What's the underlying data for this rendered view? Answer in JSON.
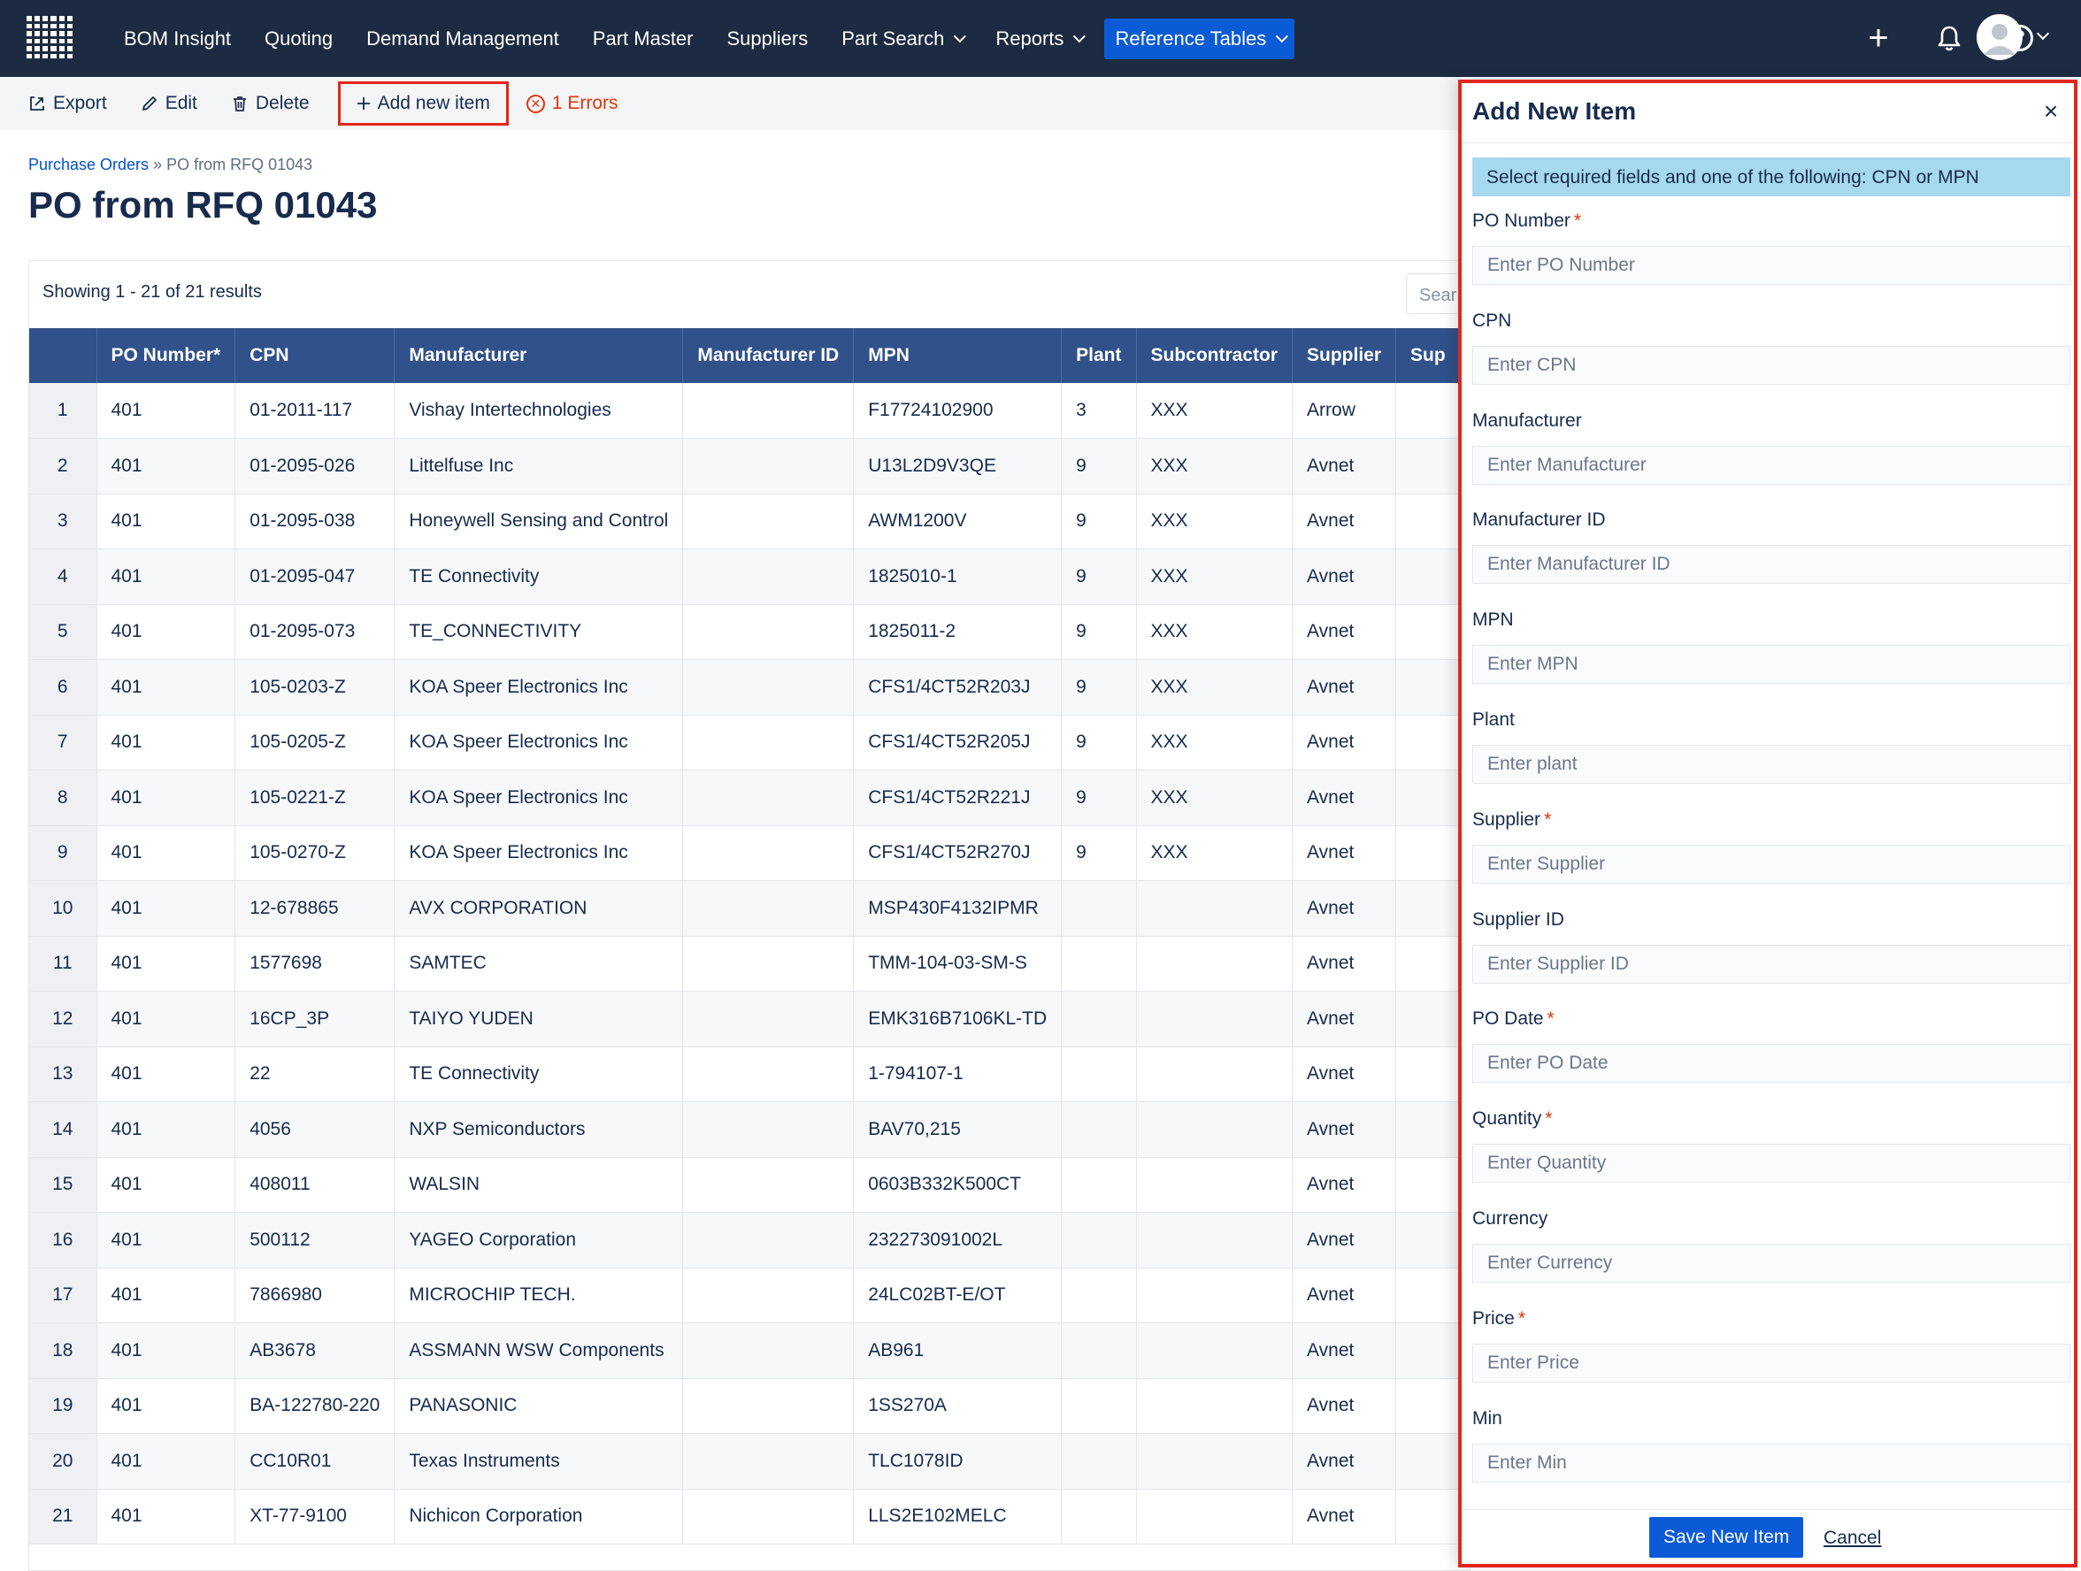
{
  "nav": {
    "items": [
      {
        "label": "BOM Insight",
        "dropdown": false
      },
      {
        "label": "Quoting",
        "dropdown": false
      },
      {
        "label": "Demand Management",
        "dropdown": false
      },
      {
        "label": "Part Master",
        "dropdown": false
      },
      {
        "label": "Suppliers",
        "dropdown": false
      },
      {
        "label": "Part Search",
        "dropdown": true
      },
      {
        "label": "Reports",
        "dropdown": true
      },
      {
        "label": "Reference Tables",
        "dropdown": true,
        "active": true
      }
    ],
    "plus_glyph": "+",
    "help_glyph": "?"
  },
  "toolbar": {
    "export": "Export",
    "edit": "Edit",
    "delete": "Delete",
    "add_new": "Add new item",
    "errors": "1 Errors"
  },
  "breadcrumb": {
    "parent": "Purchase Orders",
    "sep": "»",
    "current": "PO from RFQ 01043"
  },
  "page_title": "PO from RFQ 01043",
  "table": {
    "showing": "Showing 1 - 21 of 21 results",
    "search_placeholder": "Sear",
    "columns": [
      "PO Number*",
      "CPN",
      "Manufacturer",
      "Manufacturer ID",
      "MPN",
      "Plant",
      "Subcontractor",
      "Supplier",
      "Sup"
    ],
    "rows": [
      [
        "1",
        "401",
        "01-2011-117",
        "Vishay Intertechnologies",
        "",
        "F17724102900",
        "3",
        "XXX",
        "Arrow",
        ""
      ],
      [
        "2",
        "401",
        "01-2095-026",
        "Littelfuse Inc",
        "",
        "U13L2D9V3QE",
        "9",
        "XXX",
        "Avnet",
        ""
      ],
      [
        "3",
        "401",
        "01-2095-038",
        "Honeywell Sensing and Control",
        "",
        "AWM1200V",
        "9",
        "XXX",
        "Avnet",
        ""
      ],
      [
        "4",
        "401",
        "01-2095-047",
        "TE Connectivity",
        "",
        "1825010-1",
        "9",
        "XXX",
        "Avnet",
        ""
      ],
      [
        "5",
        "401",
        "01-2095-073",
        "TE_CONNECTIVITY",
        "",
        "1825011-2",
        "9",
        "XXX",
        "Avnet",
        ""
      ],
      [
        "6",
        "401",
        "105-0203-Z",
        "KOA Speer Electronics Inc",
        "",
        "CFS1/4CT52R203J",
        "9",
        "XXX",
        "Avnet",
        ""
      ],
      [
        "7",
        "401",
        "105-0205-Z",
        "KOA Speer Electronics Inc",
        "",
        "CFS1/4CT52R205J",
        "9",
        "XXX",
        "Avnet",
        ""
      ],
      [
        "8",
        "401",
        "105-0221-Z",
        "KOA Speer Electronics Inc",
        "",
        "CFS1/4CT52R221J",
        "9",
        "XXX",
        "Avnet",
        ""
      ],
      [
        "9",
        "401",
        "105-0270-Z",
        "KOA Speer Electronics Inc",
        "",
        "CFS1/4CT52R270J",
        "9",
        "XXX",
        "Avnet",
        ""
      ],
      [
        "10",
        "401",
        "12-678865",
        "AVX CORPORATION",
        "",
        "MSP430F4132IPMR",
        "",
        "",
        "Avnet",
        ""
      ],
      [
        "11",
        "401",
        "1577698",
        "SAMTEC",
        "",
        "TMM-104-03-SM-S",
        "",
        "",
        "Avnet",
        ""
      ],
      [
        "12",
        "401",
        "16CP_3P",
        "TAIYO YUDEN",
        "",
        "EMK316B7106KL-TD",
        "",
        "",
        "Avnet",
        ""
      ],
      [
        "13",
        "401",
        "22",
        "TE Connectivity",
        "",
        "1-794107-1",
        "",
        "",
        "Avnet",
        ""
      ],
      [
        "14",
        "401",
        "4056",
        "NXP Semiconductors",
        "",
        "BAV70,215",
        "",
        "",
        "Avnet",
        ""
      ],
      [
        "15",
        "401",
        "408011",
        "WALSIN",
        "",
        "0603B332K500CT",
        "",
        "",
        "Avnet",
        ""
      ],
      [
        "16",
        "401",
        "500112",
        "YAGEO Corporation",
        "",
        "232273091002L",
        "",
        "",
        "Avnet",
        ""
      ],
      [
        "17",
        "401",
        "7866980",
        "MICROCHIP TECH.",
        "",
        "24LC02BT-E/OT",
        "",
        "",
        "Avnet",
        ""
      ],
      [
        "18",
        "401",
        "AB3678",
        "ASSMANN WSW Components",
        "",
        "AB961",
        "",
        "",
        "Avnet",
        ""
      ],
      [
        "19",
        "401",
        "BA-122780-220",
        "PANASONIC",
        "",
        "1SS270A",
        "",
        "",
        "Avnet",
        ""
      ],
      [
        "20",
        "401",
        "CC10R01",
        "Texas Instruments",
        "",
        "TLC1078ID",
        "",
        "",
        "Avnet",
        ""
      ],
      [
        "21",
        "401",
        "XT-77-9100",
        "Nichicon Corporation",
        "",
        "LLS2E102MELC",
        "",
        "",
        "Avnet",
        ""
      ]
    ]
  },
  "panel": {
    "title": "Add New Item",
    "close_glyph": "×",
    "info": "Select required fields and one of the following: CPN or MPN",
    "fields": [
      {
        "label": "PO Number",
        "required": true,
        "placeholder": "Enter PO Number"
      },
      {
        "label": "CPN",
        "required": false,
        "placeholder": "Enter CPN"
      },
      {
        "label": "Manufacturer",
        "required": false,
        "placeholder": "Enter Manufacturer"
      },
      {
        "label": "Manufacturer ID",
        "required": false,
        "placeholder": "Enter Manufacturer ID"
      },
      {
        "label": "MPN",
        "required": false,
        "placeholder": "Enter MPN"
      },
      {
        "label": "Plant",
        "required": false,
        "placeholder": "Enter plant"
      },
      {
        "label": "Supplier",
        "required": true,
        "placeholder": "Enter Supplier"
      },
      {
        "label": "Supplier ID",
        "required": false,
        "placeholder": "Enter Supplier ID"
      },
      {
        "label": "PO Date",
        "required": true,
        "placeholder": "Enter PO Date"
      },
      {
        "label": "Quantity",
        "required": true,
        "placeholder": "Enter Quantity"
      },
      {
        "label": "Currency",
        "required": false,
        "placeholder": "Enter Currency"
      },
      {
        "label": "Price",
        "required": true,
        "placeholder": "Enter Price"
      },
      {
        "label": "Min",
        "required": false,
        "placeholder": "Enter Min"
      }
    ],
    "required_mark": "*",
    "save": "Save New Item",
    "cancel": "Cancel"
  },
  "colors": {
    "nav_bg": "#1c2b41",
    "accent": "#0b5ad6",
    "table_header": "#30518a",
    "highlight_border": "#e3261b",
    "info_bg": "#a6d8ee",
    "error": "#de350b"
  }
}
